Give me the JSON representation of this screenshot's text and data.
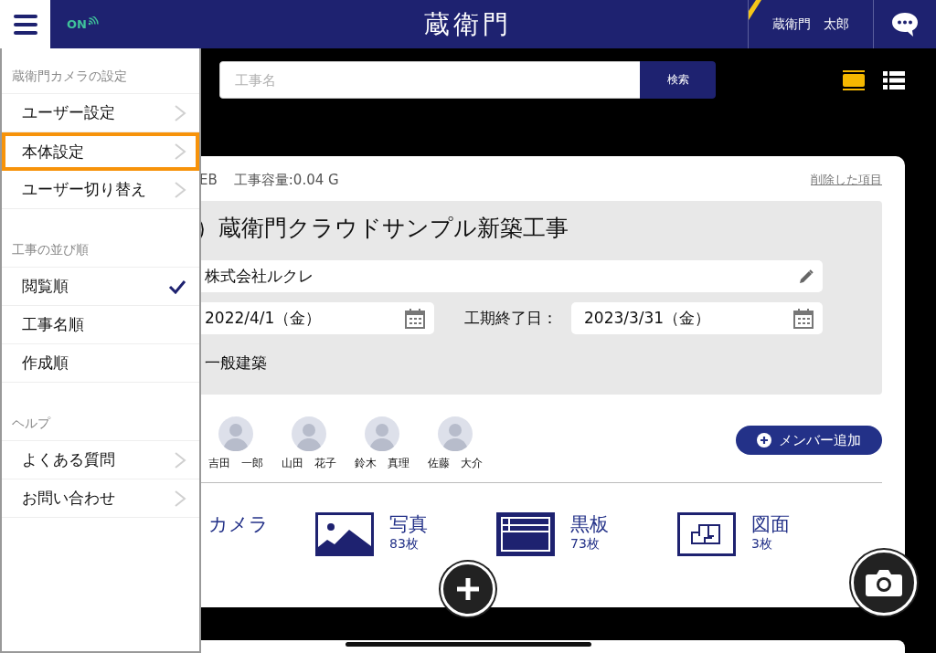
{
  "header": {
    "status": "ON",
    "logo": "蔵衛門",
    "user": "蔵衛門　太郎"
  },
  "search": {
    "placeholder": "工事名",
    "button": "検索"
  },
  "view_modes": [
    {
      "kind": "card",
      "selected": true
    },
    {
      "kind": "list",
      "selected": false
    }
  ],
  "project": {
    "meta": "EB",
    "capacity": "工事容量:0.04 G",
    "deleted_link": "削除した項目",
    "title": "）蔵衛門クラウドサンプル新築工事",
    "company": "株式会社ルクレ",
    "start_date": "2022/4/1（金）",
    "end_label": "工期終了日：",
    "end_date": "2023/3/31（金）",
    "category": "一般建築"
  },
  "members": [
    {
      "name": "吉田　一郎"
    },
    {
      "name": "山田　花子"
    },
    {
      "name": "鈴木　真理"
    },
    {
      "name": "佐藤　大介"
    }
  ],
  "add_member": "メンバー追加",
  "features": [
    {
      "kind": "camera",
      "label": "カメラ"
    },
    {
      "kind": "photo",
      "label": "写真",
      "count": "83枚"
    },
    {
      "kind": "board",
      "label": "黒板",
      "count": "73枚"
    },
    {
      "kind": "plan",
      "label": "図面",
      "count": "3枚"
    }
  ],
  "drawer": [
    {
      "title": "蔵衛門カメラの設定",
      "items": [
        {
          "kind": "link",
          "label": "ユーザー設定",
          "highlighted": false
        },
        {
          "kind": "link",
          "label": "本体設定",
          "highlighted": true
        },
        {
          "kind": "link",
          "label": "ユーザー切り替え",
          "highlighted": false
        }
      ]
    },
    {
      "title": "工事の並び順",
      "items": [
        {
          "kind": "option",
          "label": "閲覧順",
          "selected": true,
          "highlighted": false
        },
        {
          "kind": "option",
          "label": "工事名順",
          "selected": false,
          "highlighted": false
        },
        {
          "kind": "option",
          "label": "作成順",
          "selected": false,
          "highlighted": false
        }
      ]
    },
    {
      "title": "ヘルプ",
      "items": [
        {
          "kind": "link",
          "label": "よくある質問",
          "highlighted": false
        },
        {
          "kind": "link",
          "label": "お問い合わせ",
          "highlighted": false
        }
      ]
    }
  ]
}
